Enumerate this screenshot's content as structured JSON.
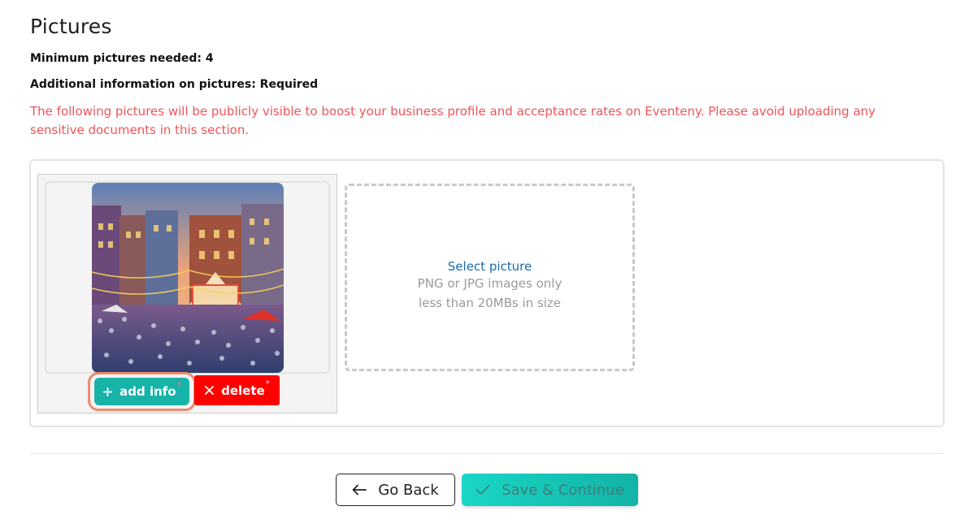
{
  "page": {
    "title": "Pictures",
    "min_pictures": "Minimum pictures needed: 4",
    "additional_info": "Additional information on pictures: Required",
    "warning": "The following pictures will be publicly visible to boost your business profile and acceptance rates on Eventeny. Please avoid uploading any sensitive documents in this section."
  },
  "picture_card": {
    "add_info_label": "add info",
    "delete_label": "delete",
    "required_mark": "*"
  },
  "upload": {
    "select_label": "Select picture",
    "hint_line1": "PNG or JPG images only",
    "hint_line2": "less than 20MBs in size"
  },
  "footer": {
    "back_label": "Go Back",
    "save_label": "Save & Continue"
  },
  "colors": {
    "accent_teal": "#17b3a8",
    "delete_red": "#ff0000",
    "warning_text": "#f0545a",
    "link_blue": "#1c6aa8",
    "focus_ring": "#f08a6c"
  },
  "icons": {
    "add": "plus-icon",
    "delete": "close-icon",
    "back": "arrow-left-icon",
    "save": "check-icon"
  }
}
